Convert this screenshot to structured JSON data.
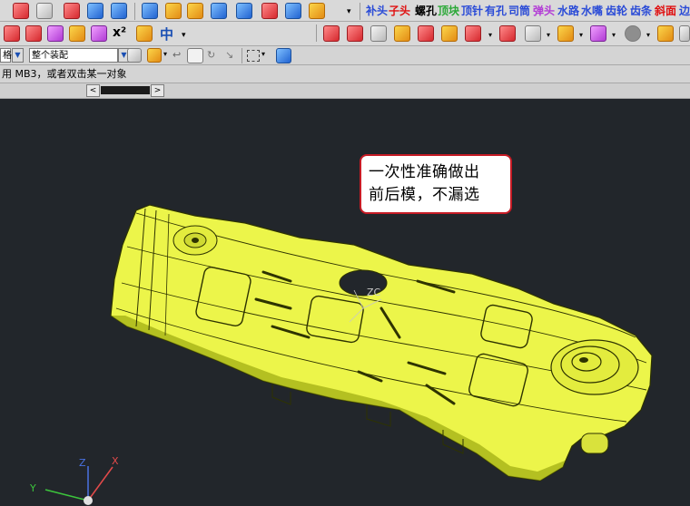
{
  "toolbar_top": {
    "mold_buttons": [
      {
        "label": "补头",
        "color": "#2a4bd7"
      },
      {
        "label": "子头",
        "color": "#e01010"
      },
      {
        "label": "螺孔",
        "color": "#000000"
      },
      {
        "label": "顶块",
        "color": "#2aa836"
      },
      {
        "label": "顶针",
        "color": "#2a4bd7"
      },
      {
        "label": "有孔",
        "color": "#2a4bd7"
      },
      {
        "label": "司筒",
        "color": "#2a4bd7"
      },
      {
        "label": "弹头",
        "color": "#b23ad6"
      },
      {
        "label": "水路",
        "color": "#2a4bd7"
      },
      {
        "label": "水嘴",
        "color": "#2a4bd7"
      },
      {
        "label": "齿轮",
        "color": "#2a4bd7"
      },
      {
        "label": "齿条",
        "color": "#2a4bd7"
      },
      {
        "label": "斜面",
        "color": "#e01010"
      },
      {
        "label": "边",
        "color": "#2a4bd7"
      }
    ]
  },
  "toolbar_mid": {
    "symbol_label": "x²",
    "chinese_label": "中"
  },
  "selection_bar": {
    "filter_value": "格",
    "scope_value": "整个装配"
  },
  "cue_line": "用 MB3，或者双击某一对象",
  "scroll": {
    "left_arrow": "<",
    "right_arrow": ">"
  },
  "callout": {
    "line1": "一次性准确做出",
    "line2": "前后模，不漏选"
  },
  "triad": {
    "x_label": "X",
    "y_label": "Y",
    "z_label": "Z"
  },
  "model_label": "ZC",
  "colors": {
    "viewport_bg": "#22262b",
    "part_fill": "#ecf54a",
    "part_shadow": "#a2ad14",
    "callout_border": "#c61b25"
  }
}
